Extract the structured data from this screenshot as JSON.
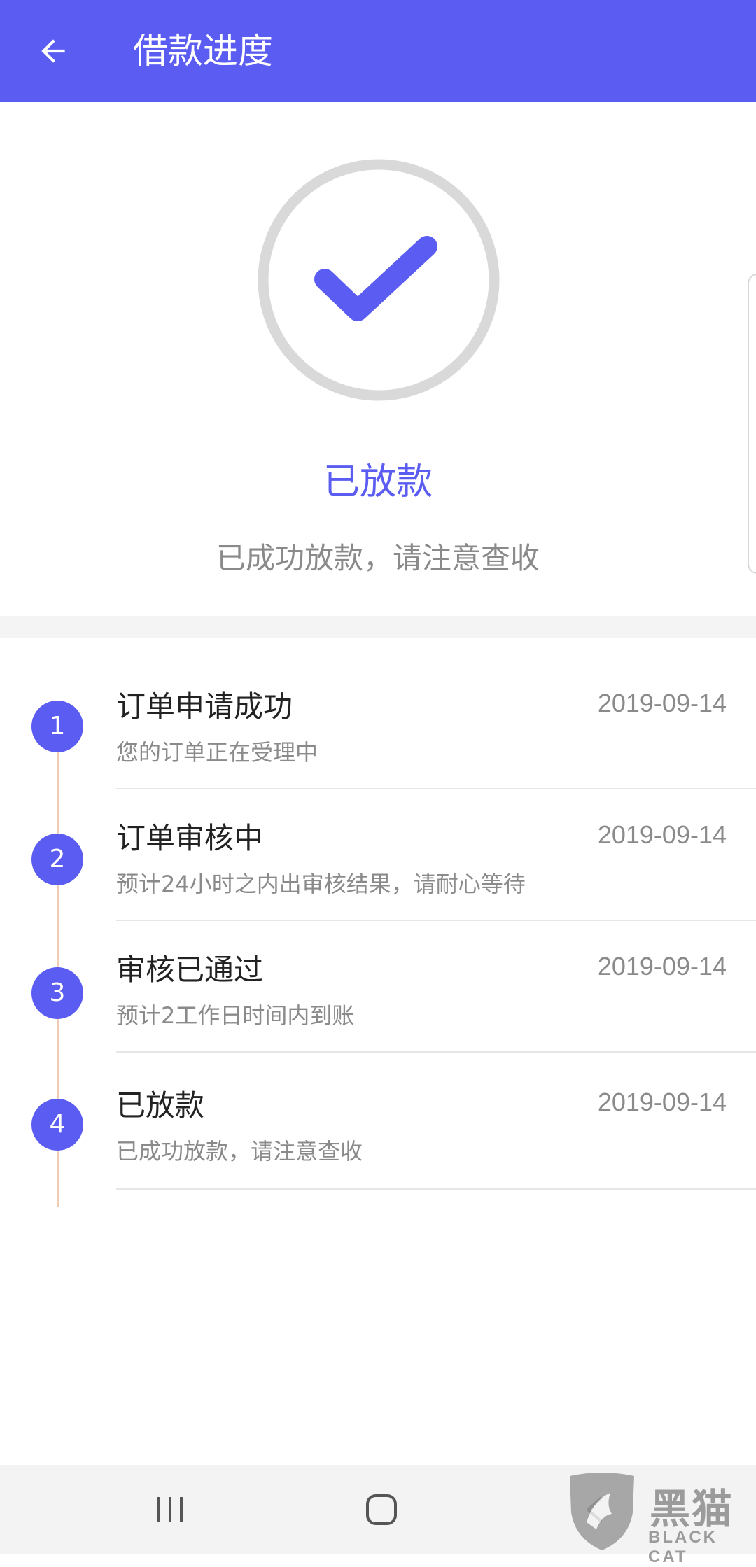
{
  "header": {
    "title": "借款进度",
    "back_icon": "arrow-left-icon",
    "background_color": "#5b5cf2"
  },
  "status": {
    "icon": "check-circle-icon",
    "title": "已放款",
    "description": "已成功放款，请注意查收",
    "accent_color": "#5b5cf2"
  },
  "steps": [
    {
      "number": "1",
      "title": "订单申请成功",
      "date": "2019-09-14",
      "description": "您的订单正在受理中"
    },
    {
      "number": "2",
      "title": "订单审核中",
      "date": "2019-09-14",
      "description": "预计24小时之内出审核结果，请耐心等待"
    },
    {
      "number": "3",
      "title": "审核已通过",
      "date": "2019-09-14",
      "description": "预计2工作日时间内到账"
    },
    {
      "number": "4",
      "title": "已放款",
      "date": "2019-09-14",
      "description": "已成功放款，请注意查收"
    }
  ],
  "navbar": {
    "recent_icon": "recent-apps-icon",
    "home_icon": "home-icon",
    "back_icon": "nav-back-icon"
  },
  "watermark": {
    "text": "黑猫",
    "subtext": "BLACK CAT"
  }
}
